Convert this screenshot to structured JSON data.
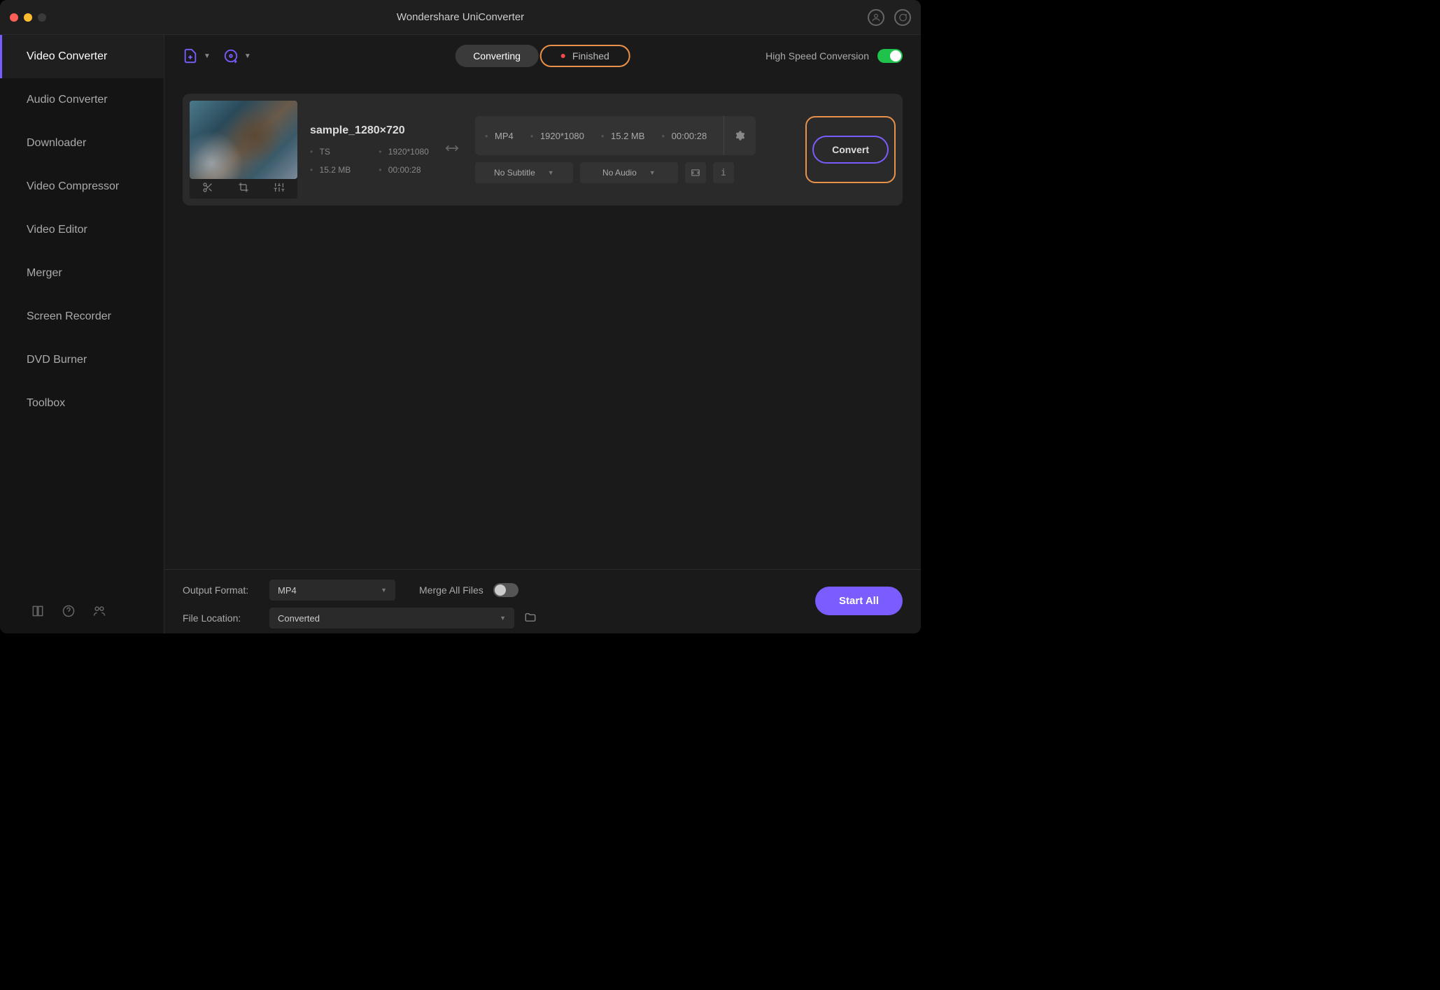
{
  "title": "Wondershare UniConverter",
  "sidebar": {
    "items": [
      {
        "label": "Video Converter"
      },
      {
        "label": "Audio Converter"
      },
      {
        "label": "Downloader"
      },
      {
        "label": "Video Compressor"
      },
      {
        "label": "Video Editor"
      },
      {
        "label": "Merger"
      },
      {
        "label": "Screen Recorder"
      },
      {
        "label": "DVD Burner"
      },
      {
        "label": "Toolbox"
      }
    ]
  },
  "toolbar": {
    "tabs": {
      "converting": "Converting",
      "finished": "Finished"
    },
    "high_speed_label": "High Speed Conversion",
    "high_speed_on": true
  },
  "file": {
    "name": "sample_1280×720",
    "source": {
      "format": "TS",
      "resolution": "1920*1080",
      "size": "15.2 MB",
      "duration": "00:00:28"
    },
    "target": {
      "format": "MP4",
      "resolution": "1920*1080",
      "size": "15.2 MB",
      "duration": "00:00:28"
    },
    "subtitle": "No Subtitle",
    "audio": "No Audio",
    "convert_label": "Convert"
  },
  "footer": {
    "output_format_label": "Output Format:",
    "output_format_value": "MP4",
    "file_location_label": "File Location:",
    "file_location_value": "Converted",
    "merge_label": "Merge All Files",
    "merge_on": false,
    "start_all": "Start All"
  }
}
